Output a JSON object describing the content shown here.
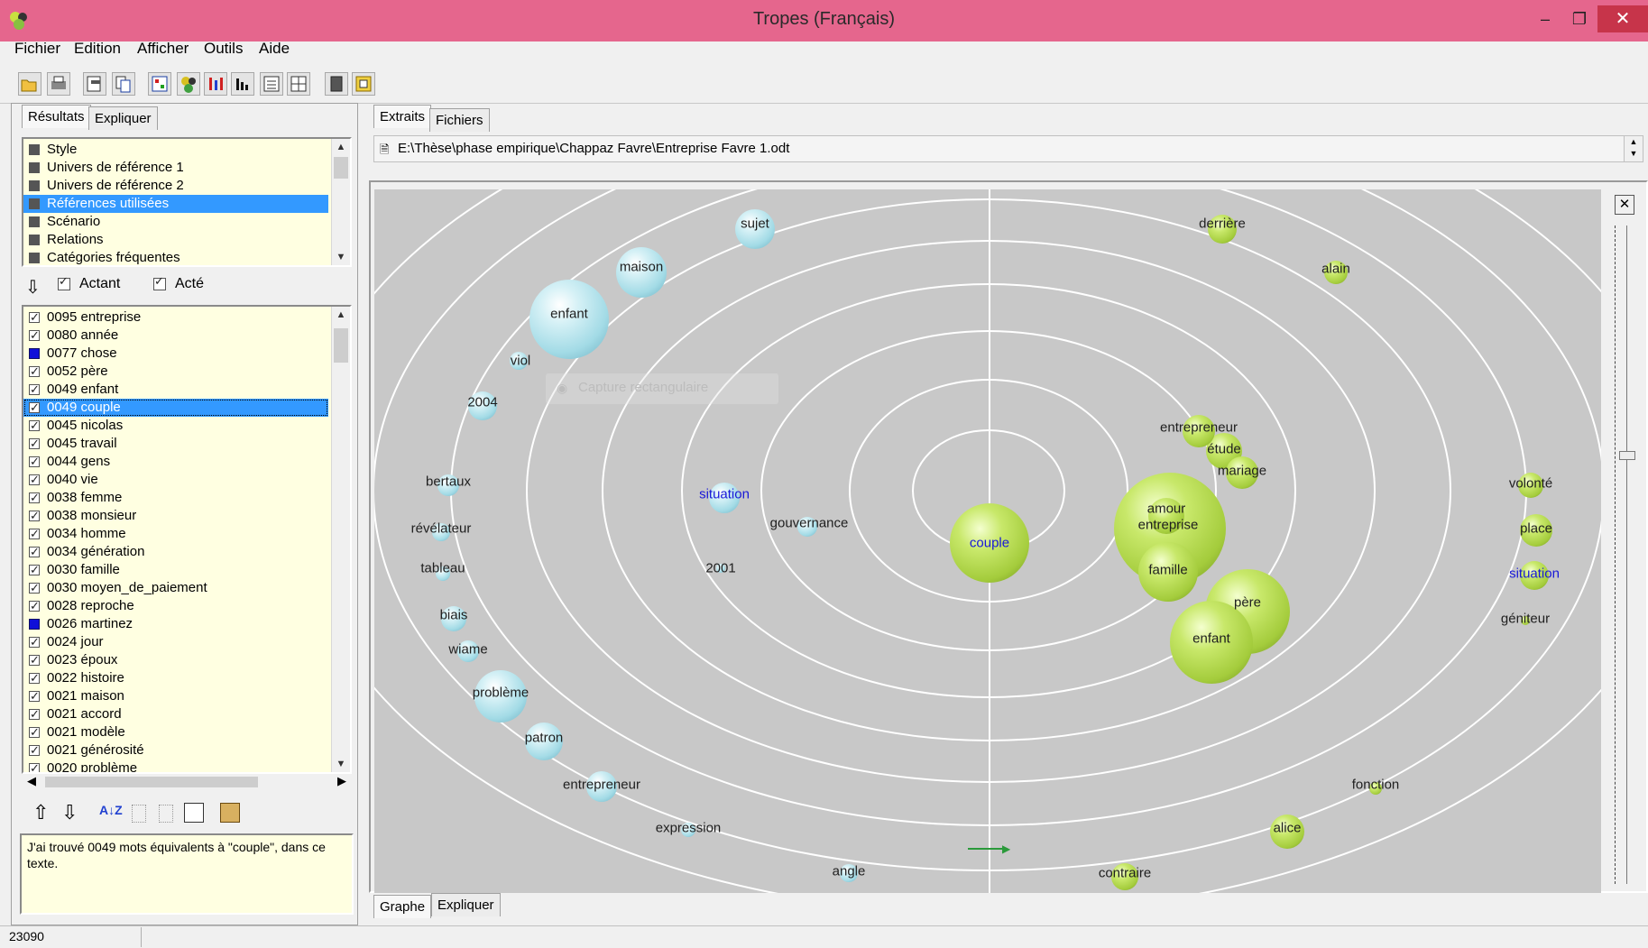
{
  "window": {
    "title": "Tropes (Français)",
    "minimize": "–",
    "restore": "❐",
    "close": "✕"
  },
  "menu": [
    "Fichier",
    "Edition",
    "Afficher",
    "Outils",
    "Aide"
  ],
  "toolbar_icons": [
    "open-icon",
    "print-icon",
    "properties-icon",
    "copy-icon",
    "grid-icon",
    "clusters-icon",
    "bars-icon",
    "histogram-icon",
    "list-icon",
    "table-icon",
    "book-icon",
    "export-icon"
  ],
  "left": {
    "tabs": [
      "Résultats",
      "Expliquer"
    ],
    "categories": [
      {
        "label": "Style",
        "selected": false
      },
      {
        "label": "Univers de référence 1",
        "selected": false
      },
      {
        "label": "Univers de référence 2",
        "selected": false
      },
      {
        "label": "Références utilisées",
        "selected": true
      },
      {
        "label": "Scénario",
        "selected": false
      },
      {
        "label": "Relations",
        "selected": false
      },
      {
        "label": "Catégories fréquentes",
        "selected": false
      }
    ],
    "filters": {
      "actant": "Actant",
      "acte": "Acté",
      "actant_checked": true,
      "acte_checked": true
    },
    "references": [
      {
        "label": "0095 entreprise",
        "mark": "check"
      },
      {
        "label": "0080 année",
        "mark": "check"
      },
      {
        "label": "0077 chose",
        "mark": "blue"
      },
      {
        "label": "0052 père",
        "mark": "check"
      },
      {
        "label": "0049 enfant",
        "mark": "check"
      },
      {
        "label": "0049 couple",
        "mark": "check",
        "selected": true
      },
      {
        "label": "0045 nicolas",
        "mark": "check"
      },
      {
        "label": "0045 travail",
        "mark": "check"
      },
      {
        "label": "0044 gens",
        "mark": "check"
      },
      {
        "label": "0040 vie",
        "mark": "check"
      },
      {
        "label": "0038 femme",
        "mark": "check"
      },
      {
        "label": "0038 monsieur",
        "mark": "check"
      },
      {
        "label": "0034 homme",
        "mark": "check"
      },
      {
        "label": "0034 génération",
        "mark": "check"
      },
      {
        "label": "0030 famille",
        "mark": "check"
      },
      {
        "label": "0030 moyen_de_paiement",
        "mark": "check"
      },
      {
        "label": "0028 reproche",
        "mark": "check"
      },
      {
        "label": "0026 martinez",
        "mark": "blue"
      },
      {
        "label": "0024 jour",
        "mark": "check"
      },
      {
        "label": "0023 époux",
        "mark": "check"
      },
      {
        "label": "0022 histoire",
        "mark": "check"
      },
      {
        "label": "0021 maison",
        "mark": "check"
      },
      {
        "label": "0021 accord",
        "mark": "check"
      },
      {
        "label": "0021 modèle",
        "mark": "check"
      },
      {
        "label": "0021 générosité",
        "mark": "check"
      },
      {
        "label": "0020 problème",
        "mark": "check"
      }
    ],
    "bottom_icons": [
      "arrow-up-icon",
      "arrow-down-icon",
      "sort-az-icon",
      "tree-expand-icon",
      "tree-collapse-icon",
      "properties-icon",
      "clipboard-icon"
    ],
    "explanation": "J'ai trouvé 0049 mots équivalents à \"couple\", dans ce texte."
  },
  "right": {
    "tabs": [
      "Extraits",
      "Fichiers"
    ],
    "file_path": "E:\\Thèse\\phase empirique\\Chappaz Favre\\Entreprise Favre 1.odt",
    "bottom_tabs": [
      "Graphe",
      "Expliquer"
    ],
    "ghost_tooltip": "Capture rectangulaire"
  },
  "graph": {
    "center": "couple",
    "actants": [
      {
        "label": "sujet"
      },
      {
        "label": "maison"
      },
      {
        "label": "enfant"
      },
      {
        "label": "viol"
      },
      {
        "label": "2004"
      },
      {
        "label": "situation",
        "blue": true
      },
      {
        "label": "gouvernance"
      },
      {
        "label": "2001"
      },
      {
        "label": "bertaux"
      },
      {
        "label": "révélateur"
      },
      {
        "label": "tableau"
      },
      {
        "label": "biais"
      },
      {
        "label": "wiame"
      },
      {
        "label": "problème"
      },
      {
        "label": "patron"
      },
      {
        "label": "entrepreneur"
      },
      {
        "label": "expression"
      },
      {
        "label": "angle"
      }
    ],
    "actes": [
      {
        "label": "derrière"
      },
      {
        "label": "alain"
      },
      {
        "label": "entrepreneur"
      },
      {
        "label": "étude"
      },
      {
        "label": "mariage"
      },
      {
        "label": "amour"
      },
      {
        "label": "entreprise"
      },
      {
        "label": "famille"
      },
      {
        "label": "père"
      },
      {
        "label": "enfant"
      },
      {
        "label": "volonté"
      },
      {
        "label": "place"
      },
      {
        "label": "situation",
        "blue": true
      },
      {
        "label": "géniteur"
      },
      {
        "label": "fonction"
      },
      {
        "label": "alice"
      },
      {
        "label": "contraire"
      }
    ]
  },
  "status": {
    "count": "23090"
  }
}
